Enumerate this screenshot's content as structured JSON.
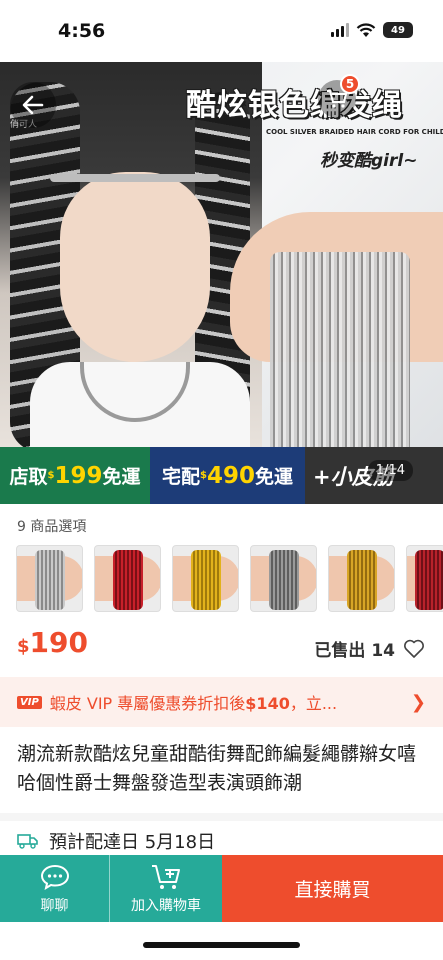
{
  "status_bar": {
    "time": "4:56",
    "battery": "49"
  },
  "hero": {
    "title": "酷炫银色编发绳",
    "subtitle": "COOL SILVER BRAIDED HAIR CORD FOR CHILDREN",
    "tagline": "秒变酷girl~",
    "watermark": "俏可人",
    "cart_count": "5",
    "image_counter": "1/14",
    "shipping": {
      "store_prefix": "店取",
      "store_currency": "$",
      "store_amount": "199",
      "store_suffix": "免運",
      "home_prefix": "宅配",
      "home_currency": "$",
      "home_amount": "490",
      "home_suffix": "免運",
      "extra": "+小皮筋"
    }
  },
  "variants": {
    "count_label": "9 商品選項",
    "colors": [
      "#c9c9c9",
      "#c8202a",
      "#e2b21c",
      "#9a9a9a",
      "#d8a526",
      "#b8222b"
    ]
  },
  "price": {
    "currency": "$",
    "value": "190"
  },
  "sold": {
    "label": "已售出 14"
  },
  "vip": {
    "badge": "VIP",
    "text_before": "蝦皮 VIP 專屬優惠券折扣後",
    "amount": "$140",
    "text_after": "，立..."
  },
  "product_title": "潮流新款酷炫兒童甜酷街舞配飾編髮繩髒辮女嘻哈個性爵士舞盤發造型表演頭飾潮",
  "delivery": {
    "text": "預計配達日 5月18日"
  },
  "bottom_bar": {
    "chat_label": "聊聊",
    "cart_label": "加入購物車",
    "buy_label": "直接購買"
  },
  "colors": {
    "accent": "#ee4d2d",
    "teal": "#26aa99"
  }
}
